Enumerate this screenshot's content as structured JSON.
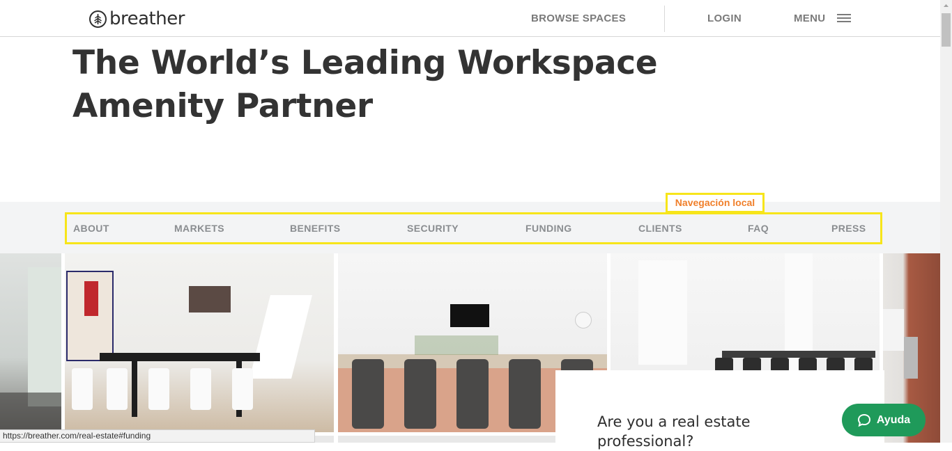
{
  "header": {
    "logo_text": "breather",
    "browse_label": "BROWSE SPACES",
    "login_label": "LOGIN",
    "menu_label": "MENU"
  },
  "hero": {
    "title_line1": "The World’s Leading Workspace",
    "title_line2": "Amenity Partner"
  },
  "local_nav": {
    "annotation": "Navegación local",
    "items": [
      {
        "label": "ABOUT"
      },
      {
        "label": "MARKETS"
      },
      {
        "label": "BENEFITS"
      },
      {
        "label": "SECURITY"
      },
      {
        "label": "FUNDING"
      },
      {
        "label": "CLIENTS"
      },
      {
        "label": "FAQ"
      },
      {
        "label": "PRESS"
      }
    ]
  },
  "card": {
    "title": "Are you a real estate professional?"
  },
  "help": {
    "label": "Ayuda",
    "icon": "chat-bubble-icon"
  },
  "status_bar": {
    "url": "https://breather.com/real-estate#funding"
  },
  "colors": {
    "annotation_border": "#f7e51a",
    "annotation_text": "#f07f2a",
    "help_button": "#1f9a5a",
    "nav_text": "#7a7a7a"
  }
}
